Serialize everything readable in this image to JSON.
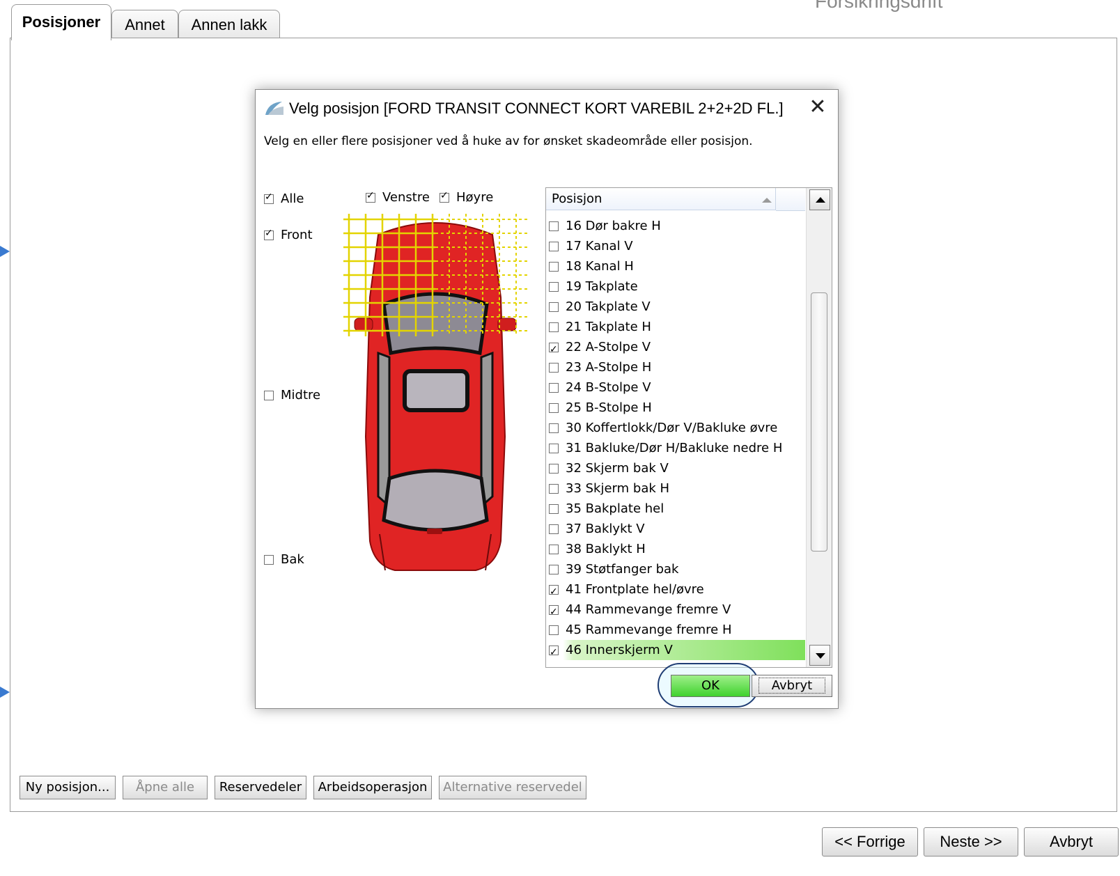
{
  "brand": "Forsikringsdrift",
  "tabs": [
    {
      "label": "Posisjoner"
    },
    {
      "label": "Annet"
    },
    {
      "label": "Annen lakk"
    }
  ],
  "toolbar": [
    {
      "label": "Ny posisjon...",
      "enabled": true
    },
    {
      "label": "Åpne alle",
      "enabled": false
    },
    {
      "label": "Reservedeler",
      "enabled": true
    },
    {
      "label": "Arbeidsoperasjon",
      "enabled": true
    },
    {
      "label": "Alternative reservedel",
      "enabled": false
    }
  ],
  "nav": {
    "prev": "<< Forrige",
    "next": "Neste >>",
    "cancel": "Avbryt"
  },
  "dialog": {
    "title": "Velg posisjon [FORD TRANSIT CONNECT KORT VAREBIL 2+2+2D FL.]",
    "instruction": "Velg en eller flere posisjoner ved å huke av for ønsket skadeområde eller posisjon.",
    "filters": {
      "alle": {
        "label": "Alle",
        "checked": true
      },
      "venstre": {
        "label": "Venstre",
        "checked": true
      },
      "hoyre": {
        "label": "Høyre",
        "checked": true
      },
      "front": {
        "label": "Front",
        "checked": true
      },
      "midtre": {
        "label": "Midtre",
        "checked": false
      },
      "bak": {
        "label": "Bak",
        "checked": false
      }
    },
    "list_header": "Posisjon",
    "positions": [
      {
        "label": "16 Dør bakre H",
        "checked": false
      },
      {
        "label": "17 Kanal V",
        "checked": false
      },
      {
        "label": "18 Kanal H",
        "checked": false
      },
      {
        "label": "19 Takplate",
        "checked": false
      },
      {
        "label": "20 Takplate V",
        "checked": false
      },
      {
        "label": "21 Takplate H",
        "checked": false
      },
      {
        "label": "22 A-Stolpe V",
        "checked": true
      },
      {
        "label": "23 A-Stolpe H",
        "checked": false
      },
      {
        "label": "24 B-Stolpe V",
        "checked": false
      },
      {
        "label": "25 B-Stolpe H",
        "checked": false
      },
      {
        "label": "30 Koffertlokk/Dør V/Bakluke øvre",
        "checked": false
      },
      {
        "label": "31 Bakluke/Dør H/Bakluke nedre H",
        "checked": false
      },
      {
        "label": "32 Skjerm bak V",
        "checked": false
      },
      {
        "label": "33 Skjerm bak H",
        "checked": false
      },
      {
        "label": "35 Bakplate hel",
        "checked": false
      },
      {
        "label": "37 Baklykt V",
        "checked": false
      },
      {
        "label": "38 Baklykt H",
        "checked": false
      },
      {
        "label": "39 Støtfanger bak",
        "checked": false
      },
      {
        "label": "41 Frontplate hel/øvre",
        "checked": true
      },
      {
        "label": "44 Rammevange fremre V",
        "checked": true
      },
      {
        "label": "45 Rammevange fremre H",
        "checked": false
      },
      {
        "label": "46 Innerskjerm V",
        "checked": true,
        "selected": true
      }
    ],
    "ok": "OK",
    "cancel": "Avbryt"
  },
  "colors": {
    "car": "#e02424",
    "grid": "#e3d400",
    "ok_green": "#3fd22e",
    "accent": "#3a7ad0"
  }
}
